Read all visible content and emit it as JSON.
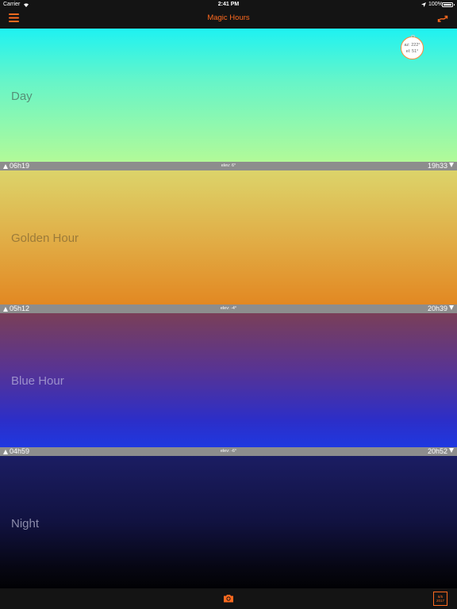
{
  "status_bar": {
    "carrier": "Carrier",
    "time": "2:41 PM",
    "battery": "100%"
  },
  "nav": {
    "title": "Magic Hours",
    "accent_color": "#ff6a1f"
  },
  "sun_badge": {
    "azimuth": "az: 222°",
    "elevation": "el: 51°"
  },
  "bands": {
    "day": {
      "label": "Day"
    },
    "golden": {
      "label": "Golden Hour"
    },
    "blue": {
      "label": "Blue Hour"
    },
    "night": {
      "label": "Night"
    }
  },
  "separators": [
    {
      "rise": "06h19",
      "elevation": "elev: 6°",
      "set": "19h33"
    },
    {
      "rise": "05h12",
      "elevation": "elev: -4°",
      "set": "20h39"
    },
    {
      "rise": "04h59",
      "elevation": "elev: -6°",
      "set": "20h52"
    }
  ],
  "tab_bar": {
    "calendar_day": "6/5",
    "calendar_year": "2017"
  },
  "icons": {
    "menu": "hamburger-menu-icon",
    "tool": "exchange-arrows-icon",
    "camera": "camera-icon",
    "calendar": "calendar-icon",
    "sunrise_marker": "triangle-up-icon",
    "sunset_marker": "triangle-down-icon"
  }
}
